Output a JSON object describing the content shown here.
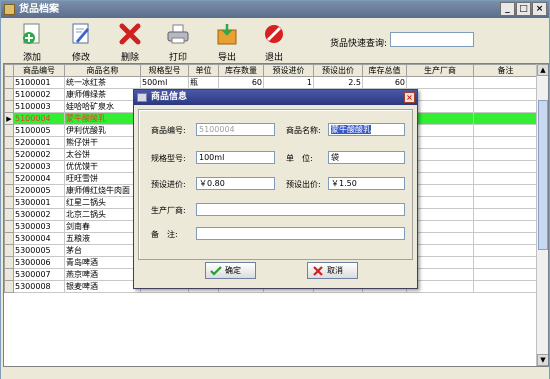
{
  "window": {
    "title": "货品档案"
  },
  "toolbar": {
    "add": "添加",
    "edit": "修改",
    "delete": "删除",
    "print": "打印",
    "export": "导出",
    "exit": "退出",
    "search_label": "货品快速查询:",
    "search_value": ""
  },
  "grid": {
    "columns": [
      "商品编号",
      "商品名称",
      "规格型号",
      "单位",
      "库存数量",
      "预设进价",
      "预设出价",
      "库存总值",
      "生产厂商",
      "备注"
    ],
    "rows": [
      [
        "5100001",
        "统一冰红茶",
        "500ml",
        "瓶",
        "60",
        "1",
        "2.5",
        "60",
        "",
        ""
      ],
      [
        "5100002",
        "康师傅绿茶",
        "",
        "",
        "",
        "",
        "",
        "",
        "",
        ""
      ],
      [
        "5100003",
        "娃哈哈矿泉水",
        "",
        "",
        "",
        "",
        "",
        "",
        "",
        ""
      ],
      [
        "5100004",
        "蒙牛酸酸乳",
        "",
        "",
        "",
        "",
        "",
        "",
        "",
        ""
      ],
      [
        "5100005",
        "伊利优酸乳",
        "",
        "",
        "",
        "",
        "",
        "",
        "",
        ""
      ],
      [
        "5200001",
        "熊仔饼干",
        "",
        "",
        "",
        "",
        "",
        "",
        "",
        ""
      ],
      [
        "5200002",
        "太谷饼",
        "",
        "",
        "",
        "",
        "",
        "",
        "",
        ""
      ],
      [
        "5200003",
        "优优馍干",
        "",
        "",
        "",
        "",
        "",
        "",
        "",
        ""
      ],
      [
        "5200004",
        "旺旺雪饼",
        "",
        "",
        "",
        "",
        "",
        "",
        "",
        ""
      ],
      [
        "5200005",
        "康师傅红烧牛肉面",
        "",
        "",
        "",
        "",
        "",
        "",
        "",
        ""
      ],
      [
        "5300001",
        "红星二锅头",
        "",
        "",
        "",
        "",
        "",
        "",
        "",
        ""
      ],
      [
        "5300002",
        "北京二锅头",
        "",
        "",
        "",
        "",
        "",
        "",
        "",
        ""
      ],
      [
        "5300003",
        "剑南春",
        "",
        "",
        "",
        "",
        "",
        "",
        "",
        ""
      ],
      [
        "5300004",
        "五粮液",
        "",
        "",
        "",
        "",
        "",
        "",
        "",
        ""
      ],
      [
        "5300005",
        "茅台",
        "",
        "",
        "",
        "",
        "",
        "",
        "",
        ""
      ],
      [
        "5300006",
        "青岛啤酒",
        "",
        "",
        "",
        "",
        "",
        "",
        "",
        ""
      ],
      [
        "5300007",
        "燕京啤酒",
        "",
        "",
        "",
        "",
        "",
        "",
        "",
        ""
      ],
      [
        "5300008",
        "银麦啤酒",
        "",
        "",
        "",
        "",
        "",
        "",
        "",
        ""
      ]
    ],
    "selected_row": 3
  },
  "dialog": {
    "title": "商品信息",
    "code_label": "商品编号:",
    "code_value": "5100004",
    "name_label": "商品名称:",
    "name_value": "蒙牛酸酸乳",
    "spec_label": "规格型号:",
    "spec_value": "100ml",
    "unit_label": "单　位:",
    "unit_value": "袋",
    "buy_label": "预设进价:",
    "buy_value": "￥0.80",
    "sell_label": "预设出价:",
    "sell_value": "￥1.50",
    "maker_label": "生产厂商:",
    "maker_value": "",
    "note_label": "备　注:",
    "note_value": "",
    "ok_label": "确定",
    "cancel_label": "取消"
  },
  "colors": {
    "selected_row_bg": "#33ee33",
    "selected_row_text": "#ff3030",
    "dialog_title_bg": "#2a3880"
  }
}
